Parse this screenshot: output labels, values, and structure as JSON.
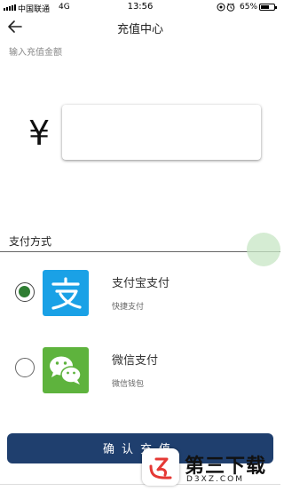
{
  "status_bar": {
    "carrier": "中国联通",
    "network": "4G",
    "time": "13:56",
    "battery": "65%",
    "battery_level": 0.65
  },
  "header": {
    "title": "充值中心",
    "back_icon": "back-arrow-icon"
  },
  "amount": {
    "hint": "输入充值金额",
    "currency_symbol": "¥",
    "value": "",
    "placeholder": ""
  },
  "payment": {
    "section_label": "支付方式",
    "options": [
      {
        "name": "支付宝支付",
        "sub": "快捷支付",
        "selected": true,
        "icon": "alipay-icon",
        "color": "#1aa1e6"
      },
      {
        "name": "微信支付",
        "sub": "微信钱包",
        "selected": false,
        "icon": "wechat-icon",
        "color": "#5eb33d"
      }
    ]
  },
  "confirm": {
    "label": "确认充值"
  },
  "watermark": {
    "title": "第三下载",
    "subtitle": "D3XZ.COM"
  },
  "colors": {
    "primary_button": "#1f3f6e",
    "selected_radio": "#2e7d32",
    "watermark_accent": "#e53935"
  }
}
